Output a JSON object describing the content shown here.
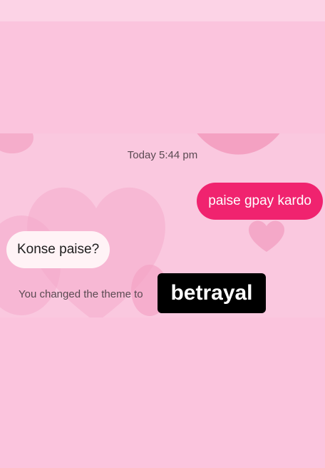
{
  "chat": {
    "timestamp": "Today 5:44 pm",
    "messages": [
      {
        "direction": "outgoing",
        "text": "paise gpay kardo"
      },
      {
        "direction": "incoming",
        "text": "Konse paise?"
      }
    ],
    "theme_notice": "You changed the theme to",
    "theme_name": "betrayal"
  },
  "colors": {
    "outgoing_bubble": "#f0236f",
    "incoming_bubble": "#fff3f6",
    "background": "#fbc4dd",
    "badge": "#000000"
  },
  "icons": [
    "heart-decoration"
  ]
}
